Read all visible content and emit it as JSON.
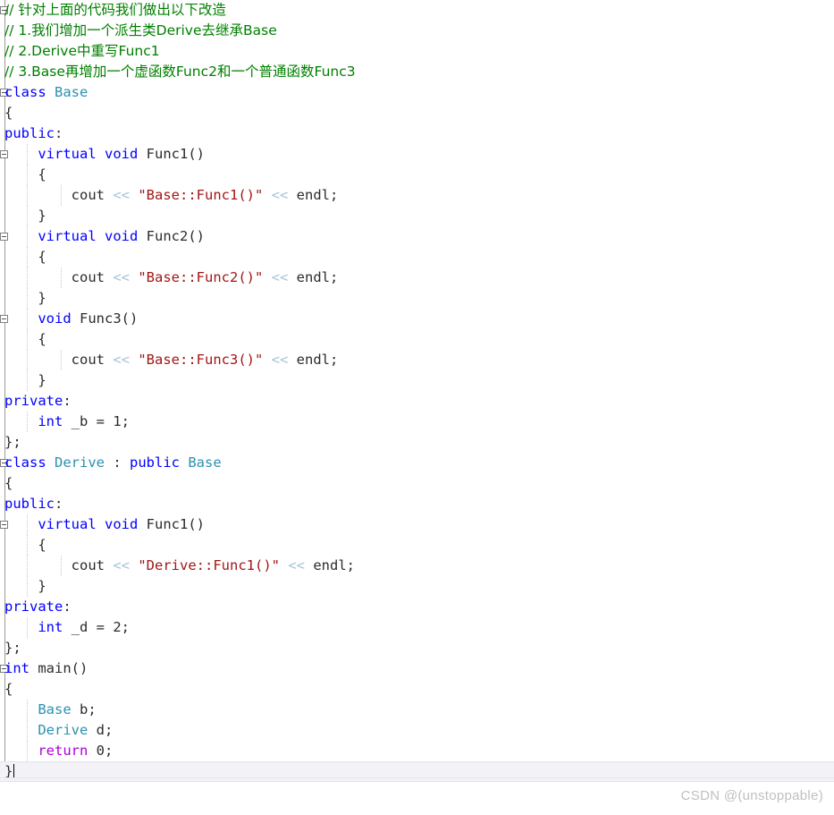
{
  "editor": {
    "background": "#ffffff",
    "language": "cpp",
    "font_size_px": 15.5,
    "line_height_px": 23,
    "current_line_index": 37,
    "caret_visible": true
  },
  "colors": {
    "comment": "#008000",
    "keyword": "#0000ff",
    "type": "#2b91af",
    "string": "#a31515",
    "control": "#af00db",
    "operator": "#a8c4d8",
    "plain": "#2b2b2b",
    "current_line_bg": "#f2f2f7",
    "watermark": "#c0c0c0",
    "fold_marker_border": "#808080"
  },
  "gutter": {
    "fold_markers": [
      {
        "line": 0,
        "state": "expanded",
        "icon": "minus-square-icon"
      },
      {
        "line": 4,
        "state": "expanded",
        "icon": "minus-square-icon"
      },
      {
        "line": 7,
        "state": "expanded",
        "icon": "minus-square-icon"
      },
      {
        "line": 11,
        "state": "expanded",
        "icon": "minus-square-icon"
      },
      {
        "line": 15,
        "state": "expanded",
        "icon": "minus-square-icon"
      },
      {
        "line": 22,
        "state": "expanded",
        "icon": "minus-square-icon"
      },
      {
        "line": 25,
        "state": "expanded",
        "icon": "minus-square-icon"
      },
      {
        "line": 32,
        "state": "expanded",
        "icon": "minus-square-icon"
      }
    ]
  },
  "code": {
    "lines": [
      {
        "indent": 0,
        "guides": [],
        "tokens": [
          {
            "t": "// 针对上面的代码我们做出以下改造",
            "c": "cmt"
          }
        ]
      },
      {
        "indent": 0,
        "guides": [],
        "tokens": [
          {
            "t": "// 1.我们增加一个派生类Derive去继承Base",
            "c": "cmt"
          }
        ]
      },
      {
        "indent": 0,
        "guides": [],
        "tokens": [
          {
            "t": "// 2.Derive中重写Func1",
            "c": "cmt"
          }
        ]
      },
      {
        "indent": 0,
        "guides": [],
        "tokens": [
          {
            "t": "// 3.Base再增加一个虚函数Func2和一个普通函数Func3",
            "c": "cmt"
          }
        ]
      },
      {
        "indent": 0,
        "guides": [],
        "tokens": [
          {
            "t": "class ",
            "c": "kw"
          },
          {
            "t": "Base",
            "c": "typ"
          }
        ]
      },
      {
        "indent": 0,
        "guides": [],
        "tokens": [
          {
            "t": "{",
            "c": "pln"
          }
        ]
      },
      {
        "indent": 0,
        "guides": [],
        "tokens": [
          {
            "t": "public",
            "c": "kw"
          },
          {
            "t": ":",
            "c": "pln"
          }
        ]
      },
      {
        "indent": 1,
        "guides": [
          30
        ],
        "tokens": [
          {
            "t": "    ",
            "c": "pln"
          },
          {
            "t": "virtual void ",
            "c": "kw"
          },
          {
            "t": "Func1()",
            "c": "pln"
          }
        ]
      },
      {
        "indent": 1,
        "guides": [
          30
        ],
        "tokens": [
          {
            "t": "    {",
            "c": "pln"
          }
        ]
      },
      {
        "indent": 2,
        "guides": [
          30,
          68
        ],
        "tokens": [
          {
            "t": "        cout ",
            "c": "pln"
          },
          {
            "t": "<<",
            "c": "op"
          },
          {
            "t": " ",
            "c": "pln"
          },
          {
            "t": "\"Base::Func1()\"",
            "c": "str"
          },
          {
            "t": " ",
            "c": "pln"
          },
          {
            "t": "<<",
            "c": "op"
          },
          {
            "t": " endl;",
            "c": "pln"
          }
        ]
      },
      {
        "indent": 1,
        "guides": [
          30
        ],
        "tokens": [
          {
            "t": "    }",
            "c": "pln"
          }
        ]
      },
      {
        "indent": 1,
        "guides": [
          30
        ],
        "tokens": [
          {
            "t": "    ",
            "c": "pln"
          },
          {
            "t": "virtual void ",
            "c": "kw"
          },
          {
            "t": "Func2()",
            "c": "pln"
          }
        ]
      },
      {
        "indent": 1,
        "guides": [
          30
        ],
        "tokens": [
          {
            "t": "    {",
            "c": "pln"
          }
        ]
      },
      {
        "indent": 2,
        "guides": [
          30,
          68
        ],
        "tokens": [
          {
            "t": "        cout ",
            "c": "pln"
          },
          {
            "t": "<<",
            "c": "op"
          },
          {
            "t": " ",
            "c": "pln"
          },
          {
            "t": "\"Base::Func2()\"",
            "c": "str"
          },
          {
            "t": " ",
            "c": "pln"
          },
          {
            "t": "<<",
            "c": "op"
          },
          {
            "t": " endl;",
            "c": "pln"
          }
        ]
      },
      {
        "indent": 1,
        "guides": [
          30
        ],
        "tokens": [
          {
            "t": "    }",
            "c": "pln"
          }
        ]
      },
      {
        "indent": 1,
        "guides": [
          30
        ],
        "tokens": [
          {
            "t": "    ",
            "c": "pln"
          },
          {
            "t": "void ",
            "c": "kw"
          },
          {
            "t": "Func3()",
            "c": "pln"
          }
        ]
      },
      {
        "indent": 1,
        "guides": [
          30
        ],
        "tokens": [
          {
            "t": "    {",
            "c": "pln"
          }
        ]
      },
      {
        "indent": 2,
        "guides": [
          30,
          68
        ],
        "tokens": [
          {
            "t": "        cout ",
            "c": "pln"
          },
          {
            "t": "<<",
            "c": "op"
          },
          {
            "t": " ",
            "c": "pln"
          },
          {
            "t": "\"Base::Func3()\"",
            "c": "str"
          },
          {
            "t": " ",
            "c": "pln"
          },
          {
            "t": "<<",
            "c": "op"
          },
          {
            "t": " endl;",
            "c": "pln"
          }
        ]
      },
      {
        "indent": 1,
        "guides": [
          30
        ],
        "tokens": [
          {
            "t": "    }",
            "c": "pln"
          }
        ]
      },
      {
        "indent": 0,
        "guides": [],
        "tokens": [
          {
            "t": "private",
            "c": "kw"
          },
          {
            "t": ":",
            "c": "pln"
          }
        ]
      },
      {
        "indent": 1,
        "guides": [
          30
        ],
        "tokens": [
          {
            "t": "    ",
            "c": "pln"
          },
          {
            "t": "int ",
            "c": "kw"
          },
          {
            "t": "_b = ",
            "c": "pln"
          },
          {
            "t": "1",
            "c": "num"
          },
          {
            "t": ";",
            "c": "pln"
          }
        ]
      },
      {
        "indent": 0,
        "guides": [],
        "tokens": [
          {
            "t": "};",
            "c": "pln"
          }
        ]
      },
      {
        "indent": 0,
        "guides": [],
        "tokens": [
          {
            "t": "class ",
            "c": "kw"
          },
          {
            "t": "Derive",
            "c": "typ"
          },
          {
            "t": " : ",
            "c": "pln"
          },
          {
            "t": "public ",
            "c": "kw"
          },
          {
            "t": "Base",
            "c": "typ"
          }
        ]
      },
      {
        "indent": 0,
        "guides": [],
        "tokens": [
          {
            "t": "{",
            "c": "pln"
          }
        ]
      },
      {
        "indent": 0,
        "guides": [],
        "tokens": [
          {
            "t": "public",
            "c": "kw"
          },
          {
            "t": ":",
            "c": "pln"
          }
        ]
      },
      {
        "indent": 1,
        "guides": [
          30
        ],
        "tokens": [
          {
            "t": "    ",
            "c": "pln"
          },
          {
            "t": "virtual void ",
            "c": "kw"
          },
          {
            "t": "Func1()",
            "c": "pln"
          }
        ]
      },
      {
        "indent": 1,
        "guides": [
          30
        ],
        "tokens": [
          {
            "t": "    {",
            "c": "pln"
          }
        ]
      },
      {
        "indent": 2,
        "guides": [
          30,
          68
        ],
        "tokens": [
          {
            "t": "        cout ",
            "c": "pln"
          },
          {
            "t": "<<",
            "c": "op"
          },
          {
            "t": " ",
            "c": "pln"
          },
          {
            "t": "\"Derive::Func1()\"",
            "c": "str"
          },
          {
            "t": " ",
            "c": "pln"
          },
          {
            "t": "<<",
            "c": "op"
          },
          {
            "t": " endl;",
            "c": "pln"
          }
        ]
      },
      {
        "indent": 1,
        "guides": [
          30
        ],
        "tokens": [
          {
            "t": "    }",
            "c": "pln"
          }
        ]
      },
      {
        "indent": 0,
        "guides": [],
        "tokens": [
          {
            "t": "private",
            "c": "kw"
          },
          {
            "t": ":",
            "c": "pln"
          }
        ]
      },
      {
        "indent": 1,
        "guides": [
          30
        ],
        "tokens": [
          {
            "t": "    ",
            "c": "pln"
          },
          {
            "t": "int ",
            "c": "kw"
          },
          {
            "t": "_d = ",
            "c": "pln"
          },
          {
            "t": "2",
            "c": "num"
          },
          {
            "t": ";",
            "c": "pln"
          }
        ]
      },
      {
        "indent": 0,
        "guides": [],
        "tokens": [
          {
            "t": "};",
            "c": "pln"
          }
        ]
      },
      {
        "indent": 0,
        "guides": [],
        "tokens": [
          {
            "t": "int ",
            "c": "kw"
          },
          {
            "t": "main()",
            "c": "pln"
          }
        ]
      },
      {
        "indent": 0,
        "guides": [],
        "tokens": [
          {
            "t": "{",
            "c": "pln"
          }
        ]
      },
      {
        "indent": 1,
        "guides": [
          30
        ],
        "tokens": [
          {
            "t": "    ",
            "c": "pln"
          },
          {
            "t": "Base",
            "c": "typ"
          },
          {
            "t": " b;",
            "c": "pln"
          }
        ]
      },
      {
        "indent": 1,
        "guides": [
          30
        ],
        "tokens": [
          {
            "t": "    ",
            "c": "pln"
          },
          {
            "t": "Derive",
            "c": "typ"
          },
          {
            "t": " d;",
            "c": "pln"
          }
        ]
      },
      {
        "indent": 1,
        "guides": [
          30
        ],
        "tokens": [
          {
            "t": "    ",
            "c": "pln"
          },
          {
            "t": "return ",
            "c": "ctl"
          },
          {
            "t": "0",
            "c": "num"
          },
          {
            "t": ";",
            "c": "pln"
          }
        ]
      },
      {
        "indent": 0,
        "guides": [],
        "tokens": [
          {
            "t": "}",
            "c": "pln"
          }
        ]
      }
    ]
  },
  "watermark": {
    "text": "CSDN @(unstoppable)"
  }
}
